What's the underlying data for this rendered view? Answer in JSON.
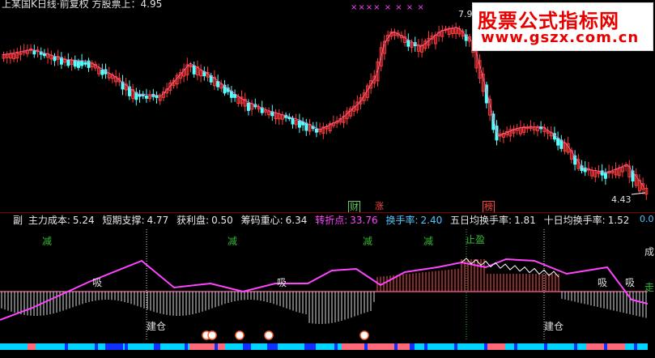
{
  "window": {
    "title": "上某国K日线·前复权 方股票上：4.95"
  },
  "logo": {
    "line1": "股票公式指标网",
    "line2": "www.gszx.com.cn"
  },
  "price_chart": {
    "high_label": "7.9",
    "low_label": "4.43",
    "top_marks": "×××× × × × ×",
    "event_tags": [
      {
        "text": "财",
        "color": "#66cc66"
      },
      {
        "text": "涨",
        "color": "#ff4444"
      },
      {
        "text": "榜",
        "color": "#ff4444"
      }
    ]
  },
  "indicator_bar": {
    "name": "副",
    "items": [
      {
        "label": "主力成本:",
        "value": "5.24",
        "color": "#e8e8e8"
      },
      {
        "label": "短期支撑:",
        "value": "4.77",
        "color": "#e8e8e8"
      },
      {
        "label": "获利盘:",
        "value": "0.50",
        "color": "#e8e8e8"
      },
      {
        "label": "筹码重心:",
        "value": "6.34",
        "color": "#e8e8e8"
      },
      {
        "label": "转折点:",
        "value": "33.76",
        "color": "#ff44ff"
      },
      {
        "label": "换手率:",
        "value": "2.40",
        "color": "#4ec8ff"
      },
      {
        "label": "五日均换手率:",
        "value": "1.81",
        "color": "#e8e8e8"
      },
      {
        "label": "十日均换手率:",
        "value": "1.52",
        "color": "#e8e8e8"
      }
    ],
    "right_value": "0.0"
  },
  "sub_chart": {
    "signals": {
      "reduce": "减",
      "stop_profit": "止盈",
      "absorb": "吸",
      "build": "建仓",
      "cheng": "成",
      "zou": "走"
    }
  },
  "colors": {
    "up": "#ff3c3c",
    "down": "#54ffff",
    "turning_line": "#ff44ff",
    "white_line": "#ffffff",
    "reduce_green": "#33bb33"
  }
}
